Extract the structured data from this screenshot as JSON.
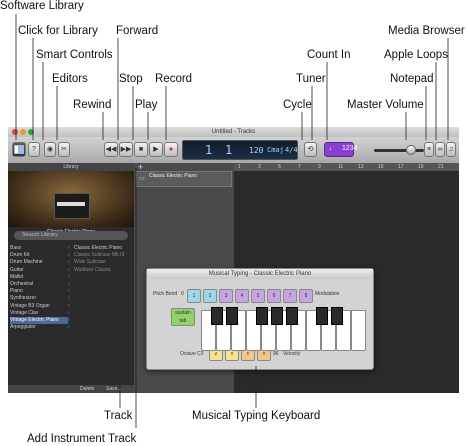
{
  "callouts": {
    "software_library": "Software Library",
    "click_for_library": "Click for Library",
    "smart_controls": "Smart Controls",
    "editors": "Editors",
    "rewind": "Rewind",
    "forward": "Forward",
    "stop": "Stop",
    "play": "Play",
    "record": "Record",
    "count_in": "Count In",
    "tuner": "Tuner",
    "cycle": "Cycle",
    "master_volume": "Master Volume",
    "media_browser": "Media Browser",
    "apple_loops": "Apple Loops",
    "notepad": "Notepad",
    "track": "Track",
    "musical_typing_keyboard": "Musical Typing Keyboard",
    "add_instrument_track": "Add Instrument Track"
  },
  "window": {
    "title": "Untitled - Tracks"
  },
  "lcd": {
    "bar": "1",
    "beat": "1",
    "tempo": "120",
    "key": "Cmaj",
    "signature": "4/4"
  },
  "library": {
    "header": "Library",
    "patch_name": "Classic Electric Piano",
    "search_placeholder": "Search Library",
    "categories": [
      "Bass",
      "Drum Kit",
      "Drum Machine",
      "Guitar",
      "Mallet",
      "Orchestral",
      "Piano",
      "Synthesizer",
      "Vintage B3 Organ",
      "Vintage Clav",
      "Vintage Electric Piano",
      "Arpeggiator"
    ],
    "selected_category": "Vintage Electric Piano",
    "patches": [
      "Classic Electric Piano",
      "Classic Suitcase Mk III",
      "Wide Suitcase",
      "Wurlitzer Classic"
    ],
    "footer": {
      "delete": "Delete",
      "save": "Save..."
    }
  },
  "track": {
    "name": "Classic Electric Piano",
    "add_symbol": "+"
  },
  "ruler": [
    "1",
    "3",
    "5",
    "7",
    "9",
    "11",
    "13",
    "15",
    "17",
    "19",
    "21"
  ],
  "musical_typing": {
    "title": "Musical Typing - Classic Electric Piano",
    "pitch_bend_label": "Pitch Bend",
    "pitch_bend_value": "0",
    "modulation_label": "Modulation",
    "sustain_label": "sustain",
    "sustain_key": "tab",
    "octave_label": "Octave",
    "octave_value": "C3",
    "velocity_label": "Velocity",
    "velocity_value": "96",
    "top_row": [
      "1",
      "2",
      "3",
      "4",
      "5",
      "6",
      "7",
      "8"
    ],
    "top_row_colors": [
      "#9fd6ea",
      "#9fd6ea",
      "#c6a5e6",
      "#c6a5e6",
      "#c6a5e6",
      "#c6a5e6",
      "#c6a5e6",
      "#c6a5e6"
    ],
    "bottom_row": [
      "z",
      "x",
      "c",
      "v"
    ],
    "bottom_row_colors": [
      "#f5e28a",
      "#f5e28a",
      "#f5c58a",
      "#f5c58a"
    ],
    "accent_green": "#8fd36a"
  }
}
